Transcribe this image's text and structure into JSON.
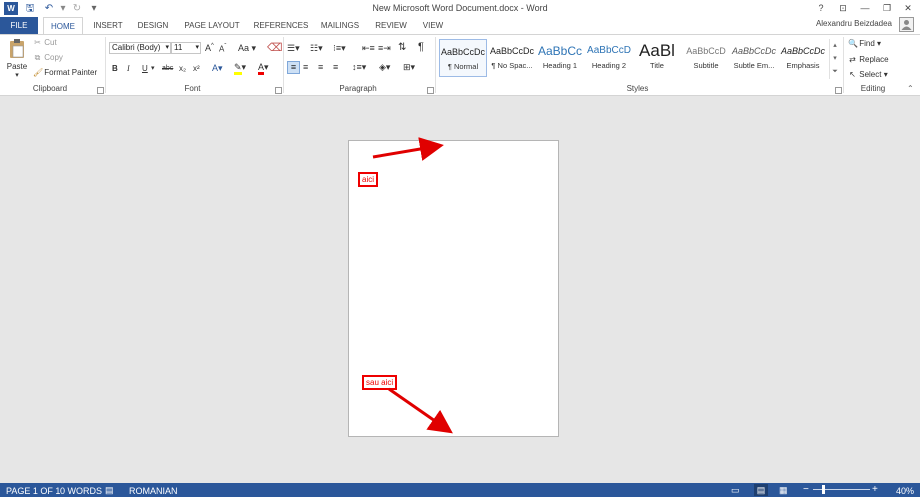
{
  "window": {
    "title": "New Microsoft Word Document.docx - Word"
  },
  "qat": {
    "word_icon": "word-logo-icon",
    "save_icon": "save-icon",
    "undo_icon": "undo-icon",
    "redo_icon": "redo-icon",
    "customize": "▾"
  },
  "window_controls": {
    "help": "?",
    "ribbon_options": "⊡",
    "minimize": "—",
    "restore": "❐",
    "close": "✕"
  },
  "tabs": [
    "FILE",
    "HOME",
    "INSERT",
    "DESIGN",
    "PAGE LAYOUT",
    "REFERENCES",
    "MAILINGS",
    "REVIEW",
    "VIEW"
  ],
  "user": {
    "name": "Alexandru Beizdadea"
  },
  "clipboard": {
    "paste": "Paste",
    "cut": "Cut",
    "copy": "Copy",
    "format_painter": "Format Painter",
    "label": "Clipboard"
  },
  "font": {
    "family": "Calibri (Body)",
    "size": "11",
    "grow": "A",
    "shrink": "A",
    "case": "Aa",
    "bold": "B",
    "italic": "I",
    "underline": "U",
    "strike": "abc",
    "sub": "x₂",
    "sup": "x²",
    "label": "Font"
  },
  "paragraph": {
    "label": "Paragraph",
    "pilcrow": "¶"
  },
  "styles": {
    "label": "Styles",
    "items": [
      {
        "preview": "AaBbCcDc",
        "name": "¶ Normal"
      },
      {
        "preview": "AaBbCcDc",
        "name": "¶ No Spac..."
      },
      {
        "preview": "AaBbCc",
        "name": "Heading 1"
      },
      {
        "preview": "AaBbCcD",
        "name": "Heading 2"
      },
      {
        "preview": "AaBl",
        "name": "Title"
      },
      {
        "preview": "AaBbCcD",
        "name": "Subtitle"
      },
      {
        "preview": "AaBbCcDc",
        "name": "Subtle Em..."
      },
      {
        "preview": "AaBbCcDc",
        "name": "Emphasis"
      }
    ]
  },
  "editing": {
    "find": "Find",
    "replace": "Replace",
    "select": "Select",
    "label": "Editing"
  },
  "document": {
    "note_top": "aici",
    "note_bottom": "sau aici"
  },
  "colors": {
    "accent": "#2b579a",
    "annotation": "#e00000"
  },
  "status": {
    "page": "PAGE 1 OF 1",
    "words": "0 WORDS",
    "language": "ROMANIAN",
    "zoom": "40%",
    "zoom_level": 0.4
  }
}
